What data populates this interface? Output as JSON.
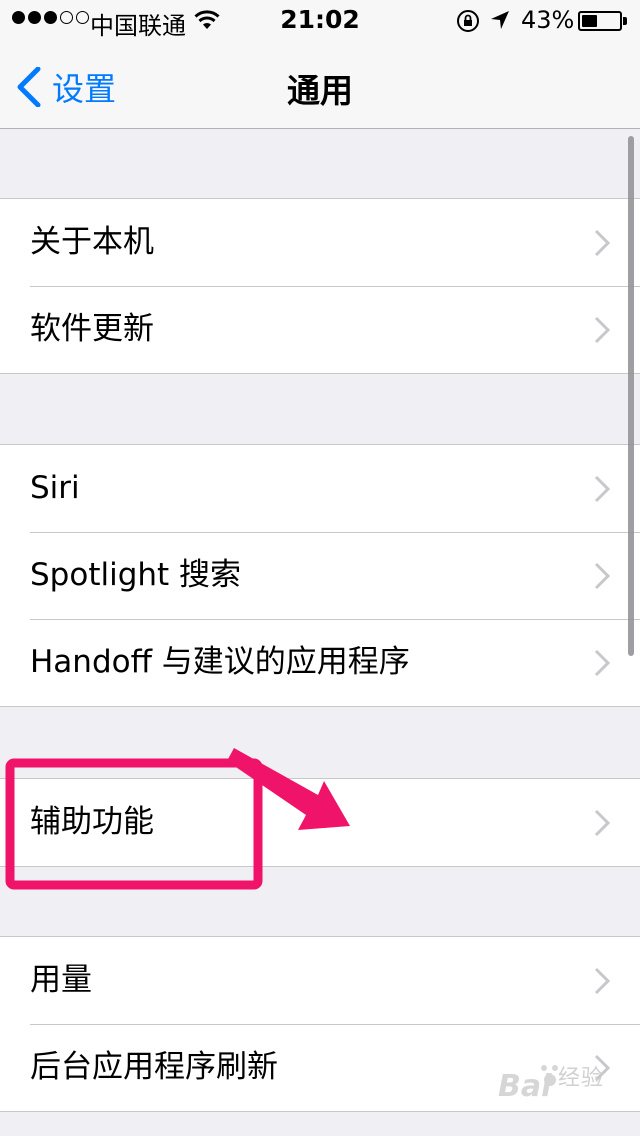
{
  "status_bar": {
    "carrier": "中国联通",
    "time": "21:02",
    "battery_percent_label": "43%",
    "battery_level": 0.43,
    "signal_bars_filled": 3,
    "signal_bars_total": 5
  },
  "nav": {
    "back_label": "设置",
    "title": "通用"
  },
  "groups": [
    {
      "items": [
        "关于本机",
        "软件更新"
      ]
    },
    {
      "items": [
        "Siri",
        "Spotlight 搜索",
        "Handoff 与建议的应用程序"
      ]
    },
    {
      "items": [
        "辅助功能"
      ]
    },
    {
      "items": [
        "用量",
        "后台应用程序刷新"
      ]
    }
  ],
  "watermark": {
    "brand": "Bai",
    "suffix": "经验"
  },
  "colors": {
    "accent": "#007aff",
    "annotation": "#f0136a",
    "background": "#efeff4"
  }
}
